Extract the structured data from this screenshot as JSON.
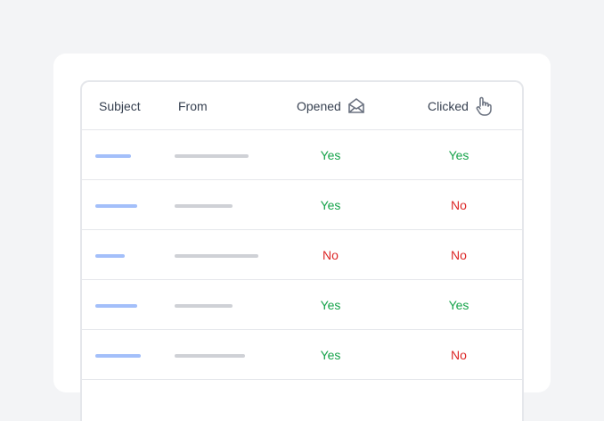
{
  "colors": {
    "yes": "#16a34a",
    "no": "#dc2626",
    "subject_placeholder": "#a3bffa",
    "from_placeholder": "#cfd1d6"
  },
  "headers": {
    "subject": "Subject",
    "from": "From",
    "opened": "Opened",
    "clicked": "Clicked",
    "opened_icon": "open-envelope-icon",
    "clicked_icon": "pointer-hand-icon"
  },
  "rows": [
    {
      "opened": "Yes",
      "clicked": "Yes"
    },
    {
      "opened": "Yes",
      "clicked": "No"
    },
    {
      "opened": "No",
      "clicked": "No"
    },
    {
      "opened": "Yes",
      "clicked": "Yes"
    },
    {
      "opened": "Yes",
      "clicked": "No"
    }
  ]
}
